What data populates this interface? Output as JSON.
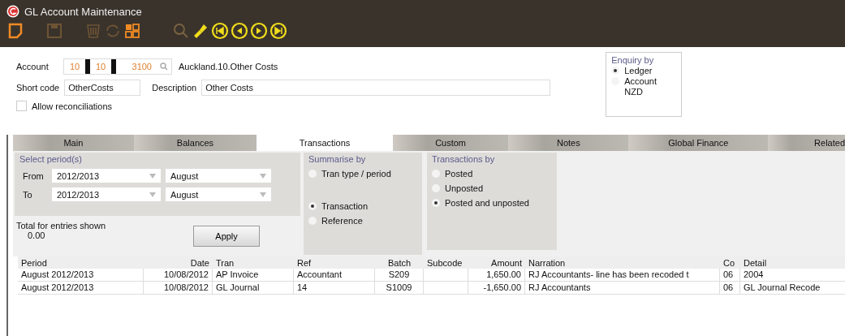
{
  "window": {
    "title": "GL Account Maintenance"
  },
  "toolbar": [
    {
      "kind": "new",
      "disabled": false
    },
    {
      "kind": "save",
      "disabled": true
    },
    {
      "kind": "delete",
      "disabled": true
    },
    {
      "kind": "refresh",
      "disabled": true
    },
    {
      "kind": "grid",
      "disabled": false
    },
    {
      "kind": "search",
      "disabled": true
    },
    {
      "kind": "flashlight",
      "disabled": false
    },
    {
      "kind": "first",
      "disabled": false
    },
    {
      "kind": "prev",
      "disabled": false
    },
    {
      "kind": "next",
      "disabled": false
    },
    {
      "kind": "last",
      "disabled": false
    }
  ],
  "account": {
    "label": "Account",
    "segments": [
      "10",
      "10",
      "3100"
    ],
    "name": "Auckland.10.Other Costs"
  },
  "short_code": {
    "label": "Short code",
    "value": "OtherCosts"
  },
  "description": {
    "label": "Description",
    "value": "Other Costs"
  },
  "allow_reconciliations": {
    "label": "Allow reconciliations",
    "checked": false
  },
  "enquiry_by": {
    "title": "Enquiry by",
    "options": [
      {
        "label": "Ledger",
        "selected": true
      },
      {
        "label": "Account",
        "selected": false
      }
    ],
    "currency": "NZD"
  },
  "tabs": [
    {
      "label": "Main",
      "selected": false
    },
    {
      "label": "Balances",
      "selected": false
    },
    {
      "label": "Transactions",
      "selected": true
    },
    {
      "label": "Custom",
      "selected": false
    },
    {
      "label": "Notes",
      "selected": false
    },
    {
      "label": "Global Finance",
      "selected": false
    },
    {
      "label": "Related",
      "selected": false
    }
  ],
  "select_periods": {
    "title": "Select period(s)",
    "rows": [
      {
        "label": "From",
        "year": "2012/2013",
        "month": "August"
      },
      {
        "label": "To",
        "year": "2012/2013",
        "month": "August"
      }
    ]
  },
  "total": {
    "label": "Total for entries shown",
    "value": "0.00"
  },
  "apply_button": "Apply",
  "summarise_by": {
    "title": "Summarise by",
    "options": [
      {
        "label": "Tran type / period",
        "selected": false
      },
      {
        "label": "Transaction",
        "selected": true
      },
      {
        "label": "Reference",
        "selected": false
      }
    ]
  },
  "transactions_by": {
    "title": "Transactions by",
    "options": [
      {
        "label": "Posted",
        "selected": false
      },
      {
        "label": "Unposted",
        "selected": false
      },
      {
        "label": "Posted and unposted",
        "selected": true
      }
    ]
  },
  "table": {
    "columns": [
      "Period",
      "Date",
      "Tran",
      "Ref",
      "Batch",
      "Subcode",
      "Amount",
      "Narration",
      "Co",
      "Detail"
    ],
    "rows": [
      [
        "August 2012/2013",
        "10/08/2012",
        "AP Invoice",
        "Accountant",
        "S209",
        "",
        "1,650.00",
        "RJ Accountants- line has been recoded t",
        "06",
        "2004"
      ],
      [
        "August 2012/2013",
        "10/08/2012",
        "GL Journal",
        "14",
        "S1009",
        "",
        "-1,650.00",
        "RJ Accountants",
        "06",
        "GL Journal Recode"
      ]
    ]
  }
}
